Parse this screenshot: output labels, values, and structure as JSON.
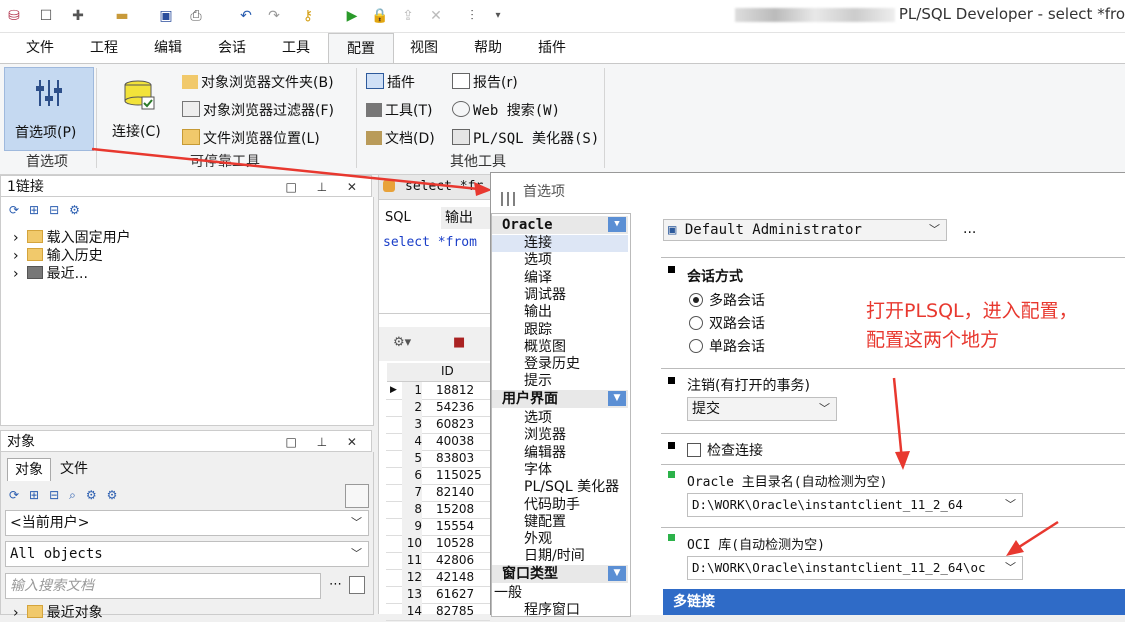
{
  "titlebar": {
    "title": "PL/SQL Developer - select *fro"
  },
  "menu": {
    "tabs": [
      "文件",
      "工程",
      "编辑",
      "会话",
      "工具",
      "配置",
      "视图",
      "帮助",
      "插件"
    ],
    "active": "配置"
  },
  "ribbon": {
    "preferences": "首选项(P)",
    "preferences_group": "首选项",
    "connect": "连接(C)",
    "obj_browser_folders": "对象浏览器文件夹(B)",
    "obj_browser_filters": "对象浏览器过滤器(F)",
    "file_browser_locations": "文件浏览器位置(L)",
    "dockable_tools_group": "可停靠工具",
    "plugins": "插件",
    "tools": "工具(T)",
    "documents": "文档(D)",
    "reports": "报告(r)",
    "web_search": "Web 搜索(W)",
    "beautifier": "PL/SQL 美化器(S)",
    "other_tools_group": "其他工具"
  },
  "connections_panel": {
    "title": "1链接",
    "items": [
      "载入固定用户",
      "输入历史",
      "最近..."
    ]
  },
  "objects_panel": {
    "title": "对象",
    "tabs": [
      "对象",
      "文件"
    ],
    "user_combo": "<当前用户>",
    "filter_combo": "All objects",
    "search_placeholder": "输入搜索文档",
    "recent_objects": "最近对象"
  },
  "sql_window": {
    "tab": "select *fr",
    "subtabs": [
      "SQL",
      "输出"
    ],
    "sql_text": "select *from",
    "grid_header": "ID",
    "rows": [
      {
        "n": "1",
        "id": "18812"
      },
      {
        "n": "2",
        "id": "54236"
      },
      {
        "n": "3",
        "id": "60823"
      },
      {
        "n": "4",
        "id": "40038"
      },
      {
        "n": "5",
        "id": "83803"
      },
      {
        "n": "6",
        "id": "115025"
      },
      {
        "n": "7",
        "id": "82140"
      },
      {
        "n": "8",
        "id": "15208"
      },
      {
        "n": "9",
        "id": "15554"
      },
      {
        "n": "10",
        "id": "10528"
      },
      {
        "n": "11",
        "id": "42806"
      },
      {
        "n": "12",
        "id": "42148"
      },
      {
        "n": "13",
        "id": "61627"
      },
      {
        "n": "14",
        "id": "82785"
      }
    ]
  },
  "dialog": {
    "title": "首选项",
    "categories": {
      "oracle_head": "Oracle",
      "oracle_items": [
        "连接",
        "选项",
        "编译",
        "调试器",
        "输出",
        "跟踪",
        "概览图",
        "登录历史",
        "提示"
      ],
      "ui_head": "用户界面",
      "ui_items": [
        "选项",
        "浏览器",
        "编辑器",
        "字体",
        "PL/SQL 美化器",
        "代码助手",
        "键配置",
        "外观",
        "日期/时间"
      ],
      "window_head": "窗口类型",
      "window_items": [
        "一般",
        "程序窗口"
      ]
    },
    "profile": "Default Administrator",
    "profile_more": "...",
    "session_mode_label": "会话方式",
    "session_options": [
      "多路会话",
      "双路会话",
      "单路会话"
    ],
    "session_selected": "多路会话",
    "logoff_label": "注销(有打开的事务)",
    "logoff_value": "提交",
    "check_connection": "检查连接",
    "oracle_home_label": "Oracle 主目录名(自动检测为空)",
    "oracle_home_value": "D:\\WORK\\Oracle\\instantclient_11_2_64",
    "oci_label": "OCI 库(自动检测为空)",
    "oci_value": "D:\\WORK\\Oracle\\instantclient_11_2_64\\oc",
    "multi_connection": "多链接"
  },
  "annotation": {
    "line1": "打开PLSQL，进入配置，",
    "line2": "配置这两个地方",
    "color": "#e8382f"
  }
}
